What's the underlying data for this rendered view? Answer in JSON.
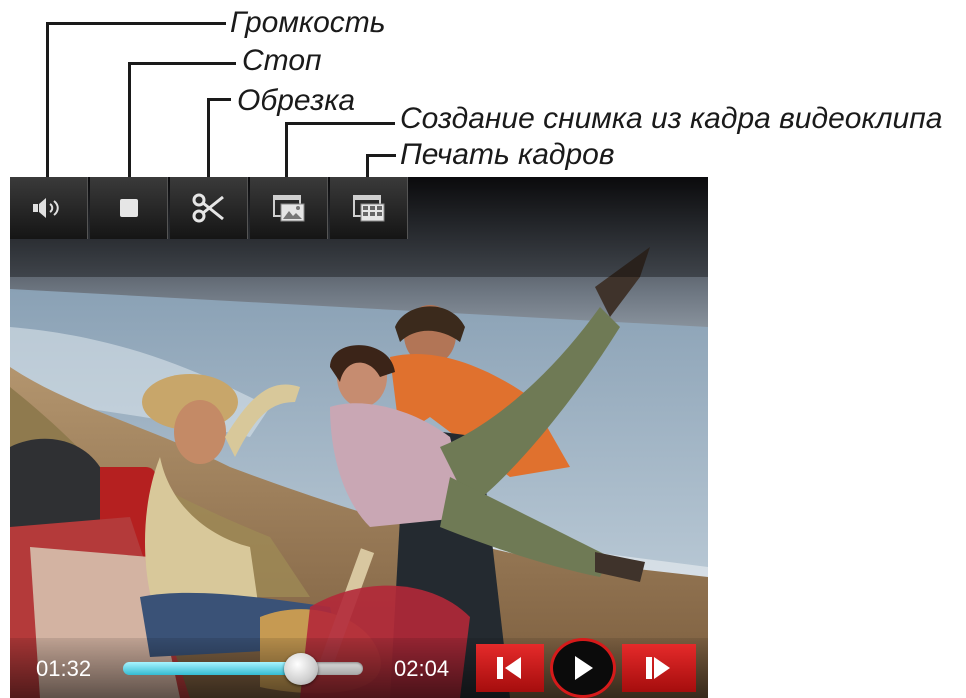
{
  "callouts": {
    "volume": "Громкость",
    "stop": "Стоп",
    "trim": "Обрезка",
    "snapshot": "Создание снимка из кадра видеоклипа",
    "print_frames": "Печать кадров"
  },
  "toolbar": {
    "buttons": [
      {
        "icon": "volume-icon"
      },
      {
        "icon": "stop-icon"
      },
      {
        "icon": "scissors-icon"
      },
      {
        "icon": "snapshot-icon"
      },
      {
        "icon": "print-frames-icon"
      }
    ]
  },
  "playback": {
    "current_time": "01:32",
    "total_time": "02:04",
    "progress": 0.74
  },
  "controls": {
    "prev_frame_icon": "step-back-icon",
    "play_icon": "play-icon",
    "next_frame_icon": "step-forward-icon"
  },
  "colors": {
    "accent_red": "#d61a1a",
    "seek_fill": "#35bcd2",
    "callout_text": "#1a1a1a"
  }
}
